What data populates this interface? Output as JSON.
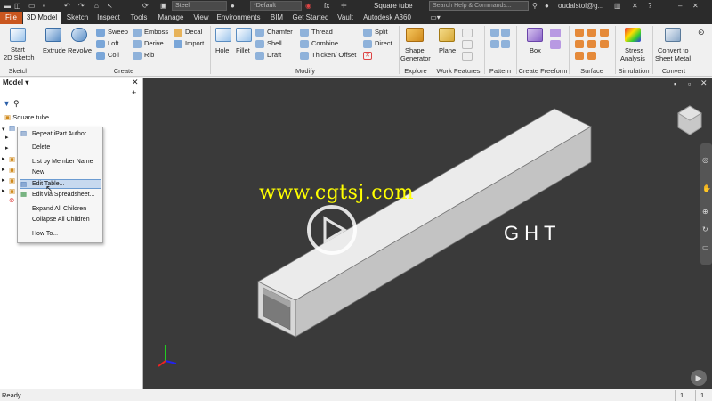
{
  "qat": {
    "material": "Steel",
    "appearance": "*Default",
    "fx": "fx",
    "title": "Square tube",
    "search_placeholder": "Search Help & Commands...",
    "user": "oudalstol@g..."
  },
  "tabs": [
    "File",
    "3D Model",
    "Sketch",
    "Inspect",
    "Tools",
    "Manage",
    "View",
    "Environments",
    "BIM",
    "Get Started",
    "Vault",
    "Autodesk A360"
  ],
  "ribbon": {
    "sketch": {
      "start": "Start",
      "sketch2d": "2D Sketch",
      "group": "Sketch"
    },
    "create": {
      "extrude": "Extrude",
      "revolve": "Revolve",
      "sweep": "Sweep",
      "loft": "Loft",
      "coil": "Coil",
      "emboss": "Emboss",
      "derive": "Derive",
      "rib": "Rib",
      "decal": "Decal",
      "import": "Import",
      "group": "Create"
    },
    "modify": {
      "hole": "Hole",
      "fillet": "Fillet",
      "chamfer": "Chamfer",
      "shell": "Shell",
      "draft": "Draft",
      "thread": "Thread",
      "combine": "Combine",
      "thicken": "Thicken/ Offset",
      "split": "Split",
      "direct": "Direct",
      "group": "Modify"
    },
    "explore": {
      "shape": "Shape",
      "generator": "Generator",
      "group": "Explore"
    },
    "work": {
      "plane": "Plane",
      "group": "Work Features"
    },
    "pattern": {
      "group": "Pattern"
    },
    "freeform": {
      "box": "Box",
      "group": "Create Freeform"
    },
    "surface": {
      "group": "Surface"
    },
    "simulation": {
      "stress": "Stress",
      "analysis": "Analysis",
      "group": "Simulation"
    },
    "convert": {
      "convert_to": "Convert to",
      "sheet_metal": "Sheet Metal",
      "group": "Convert"
    }
  },
  "browser": {
    "title": "Model",
    "root": "Square tube"
  },
  "context_menu": [
    "Repeat iPart Author",
    "Delete",
    "List by Member Name",
    "New",
    "Edit Table...",
    "Edit via Spreadsheet...",
    "Expand All Children",
    "Collapse All Children",
    "How To..."
  ],
  "viewport": {
    "watermark": "www.cgtsj.com",
    "brand_fragment": "GHT"
  },
  "status": {
    "text": "Ready",
    "count1": "1",
    "count2": "1"
  },
  "colors": {
    "accent": "#c9561f",
    "watermark": "#ffff00",
    "viewport_bg": "#3a3a3a"
  }
}
